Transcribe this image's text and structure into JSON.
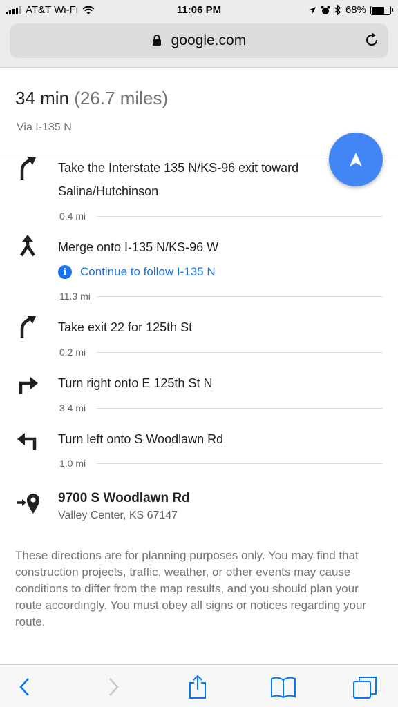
{
  "status_bar": {
    "carrier": "AT&T Wi-Fi",
    "time": "11:06 PM",
    "battery": "68%",
    "battery_level": 0.68
  },
  "browser": {
    "url": "google.com"
  },
  "route": {
    "duration": "34 min",
    "distance": "(26.7 miles)",
    "via": "Via I-135 N"
  },
  "steps": [
    {
      "icon": "slight-right-icon",
      "text": "Take the Interstate 135 N/KS-96 exit toward Salina/Hutchinson",
      "distance": "0.4 mi"
    },
    {
      "icon": "merge-icon",
      "text": "Merge onto I-135 N/KS-96 W",
      "hint": "Continue to follow I-135 N",
      "distance": "11.3 mi"
    },
    {
      "icon": "slight-right-icon",
      "text": "Take exit 22 for 125th St",
      "distance": "0.2 mi"
    },
    {
      "icon": "turn-right-icon",
      "text": "Turn right onto E 125th St N",
      "distance": "3.4 mi"
    },
    {
      "icon": "turn-left-icon",
      "text": "Turn left onto S Woodlawn Rd",
      "distance": "1.0 mi"
    }
  ],
  "destination": {
    "name": "9700 S Woodlawn Rd",
    "address": "Valley Center, KS 67147"
  },
  "disclaimer": "These directions are for planning purposes only. You may find that construction projects, traffic, weather, or other events may cause conditions to differ from the map results, and you should plan your route accordingly. You must obey all signs or notices regarding your route.",
  "colors": {
    "accent": "#4285f4",
    "link": "#1a73e8",
    "ios_blue": "#007aff"
  }
}
